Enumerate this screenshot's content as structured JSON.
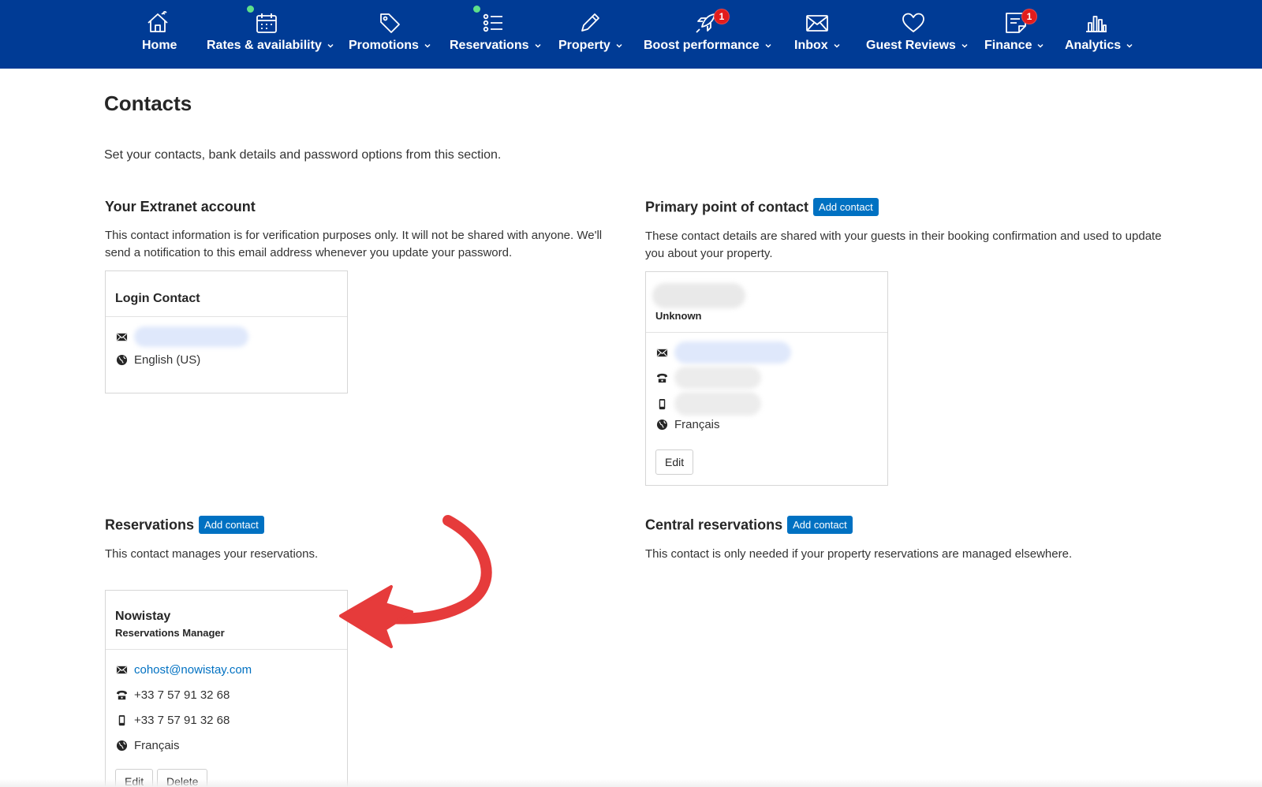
{
  "nav": {
    "items": [
      {
        "label": "Home",
        "icon": "home-icon",
        "dropdown": false
      },
      {
        "label": "Rates & availability",
        "icon": "calendar-icon",
        "dropdown": true
      },
      {
        "label": "Promotions",
        "icon": "tag-icon",
        "dropdown": true
      },
      {
        "label": "Reservations",
        "icon": "list-icon",
        "dropdown": true
      },
      {
        "label": "Property",
        "icon": "pencil-icon",
        "dropdown": true
      },
      {
        "label": "Boost performance",
        "icon": "rocket-icon",
        "dropdown": true,
        "badge": "1"
      },
      {
        "label": "Inbox",
        "icon": "envelope-icon",
        "dropdown": true
      },
      {
        "label": "Guest Reviews",
        "icon": "heart-icon",
        "dropdown": true
      },
      {
        "label": "Finance",
        "icon": "document-icon",
        "dropdown": true,
        "badge": "1"
      },
      {
        "label": "Analytics",
        "icon": "bar-chart-icon",
        "dropdown": true
      }
    ]
  },
  "page": {
    "title": "Contacts",
    "intro": "Set your contacts, bank details and password options from this section."
  },
  "extranet": {
    "title": "Your Extranet account",
    "description": "This contact information is for verification purposes only. It will not be shared with anyone. We'll send a notification to this email address whenever you update your password.",
    "card": {
      "name": "Login Contact",
      "language": "English (US)"
    }
  },
  "primary": {
    "title": "Primary point of contact",
    "add_label": "Add contact",
    "description": "These contact details are shared with your guests in their booking confirmation and used to update you about your property.",
    "card": {
      "role": "Unknown",
      "language": "Français",
      "edit_label": "Edit"
    }
  },
  "reservations": {
    "title": "Reservations",
    "add_label": "Add contact",
    "description": "This contact manages your reservations.",
    "card": {
      "name": "Nowistay",
      "role": "Reservations Manager",
      "email": "cohost@nowistay.com",
      "phone": "+33 7 57 91 32 68",
      "mobile": "+33 7 57 91 32 68",
      "language": "Français",
      "edit_label": "Edit",
      "delete_label": "Delete"
    }
  },
  "central": {
    "title": "Central reservations",
    "add_label": "Add contact",
    "description": "This contact is only needed if your property reservations are managed elsewhere."
  },
  "colors": {
    "nav_bg": "#003b95",
    "accent": "#0071c2",
    "badge": "#e21c1c",
    "status_dot": "#5ee08a",
    "annotation_arrow": "#e63b3b"
  }
}
